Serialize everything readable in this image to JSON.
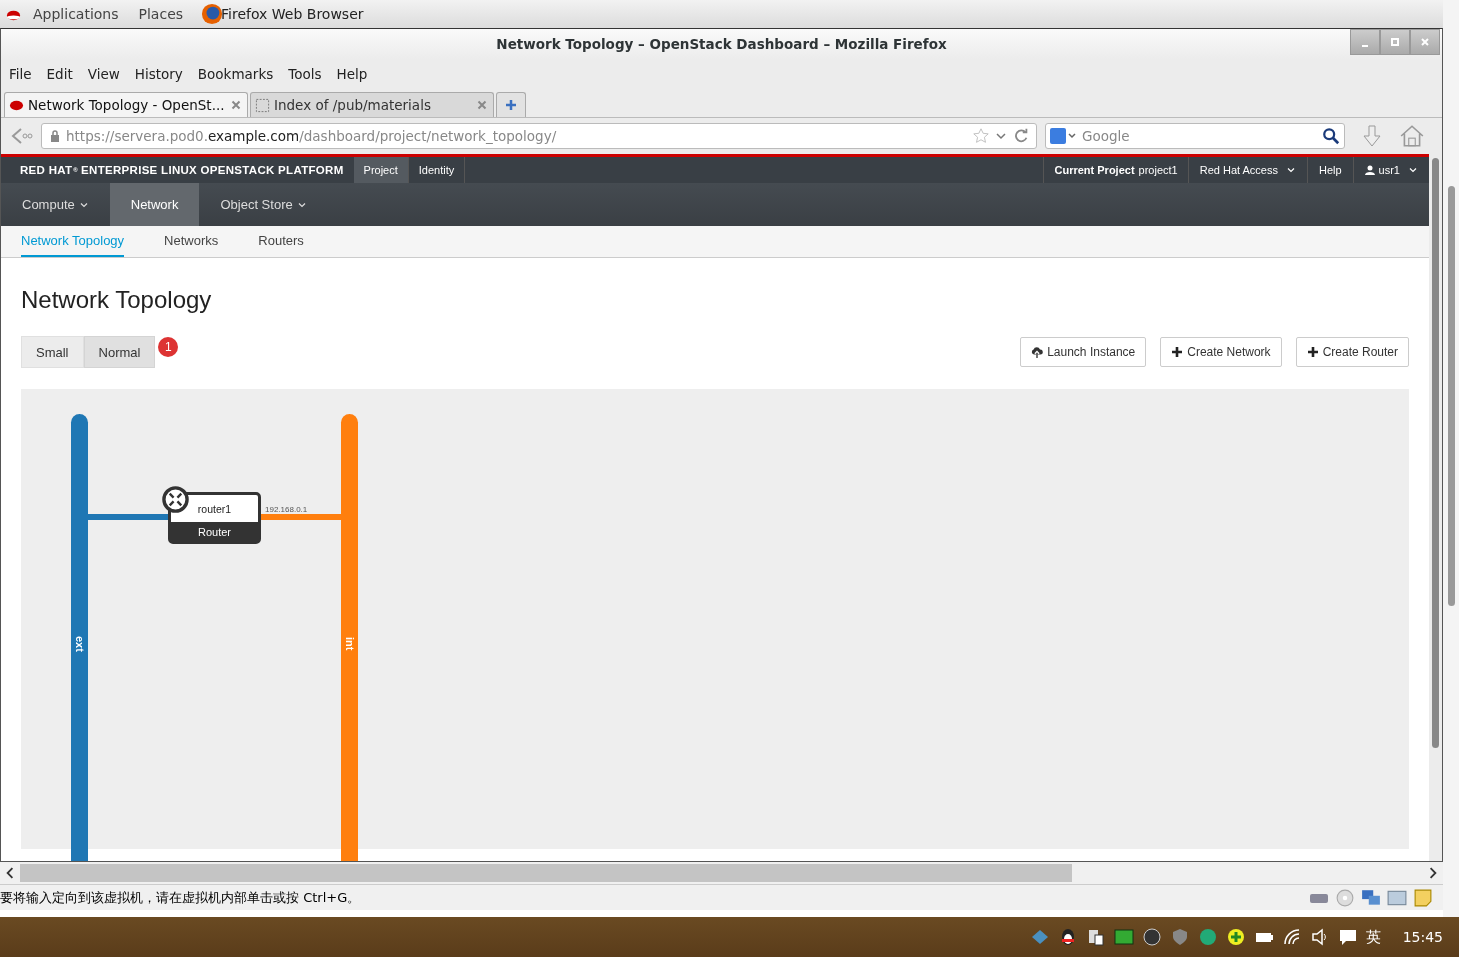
{
  "desktop_bar": {
    "menus": [
      "Applications",
      "Places"
    ],
    "app": "Firefox Web Browser"
  },
  "window": {
    "title": "Network Topology – OpenStack Dashboard – Mozilla Firefox"
  },
  "menu": [
    "File",
    "Edit",
    "View",
    "History",
    "Bookmarks",
    "Tools",
    "Help"
  ],
  "tabs": [
    {
      "label": "Network Topology - OpenSt...",
      "selected": true
    },
    {
      "label": "Index of /pub/materials",
      "selected": false
    }
  ],
  "address": {
    "prefix": "https://servera.pod0.",
    "domain": "example.com",
    "path": "/dashboard/project/network_topology/"
  },
  "search": {
    "placeholder": "Google"
  },
  "dashboard": {
    "brand": "RED HAT$^{®}$ ENTERPRISE LINUX OPENSTACK PLATFORM",
    "panels": [
      {
        "label": "Project",
        "selected": true
      },
      {
        "label": "Identity",
        "selected": false
      }
    ],
    "current_project": "**Current Project** project1",
    "right_menu": [
      {
        "label": "Red Hat Access",
        "kind": "dropdown"
      },
      {
        "label": "Help",
        "kind": "link"
      },
      {
        "label": "usr1",
        "kind": "user"
      }
    ],
    "nav": [
      {
        "label": "Compute",
        "selected": false,
        "dropdown": true
      },
      {
        "label": "Network",
        "selected": true,
        "dropdown": false
      },
      {
        "label": "Object Store",
        "selected": false,
        "dropdown": true
      }
    ],
    "subnav": [
      {
        "label": "Network Topology",
        "selected": true
      },
      {
        "label": "Networks",
        "selected": false
      },
      {
        "label": "Routers",
        "selected": false
      }
    ]
  },
  "page": {
    "heading": "Network Topology",
    "size_toggle": [
      {
        "label": "Small",
        "selected": false
      },
      {
        "label": "Normal",
        "selected": true
      }
    ],
    "badge": "1",
    "actions": [
      {
        "label": "Launch Instance",
        "kind": "launch"
      },
      {
        "label": "Create Network",
        "kind": "create"
      },
      {
        "label": "Create Router",
        "kind": "create"
      }
    ]
  },
  "topology": {
    "networks": [
      {
        "name": "ext",
        "color": "#1f77b4"
      },
      {
        "name": "int",
        "color": "#ff7f0e"
      }
    ],
    "router": {
      "name": "router1",
      "type": "Router",
      "port_label": "192.168.0.1"
    }
  },
  "vm_status": "要将输入定向到该虚拟机，请在虚拟机内部单击或按 Ctrl+G。",
  "taskbar": {
    "ime": "英",
    "clock": "15:45"
  }
}
